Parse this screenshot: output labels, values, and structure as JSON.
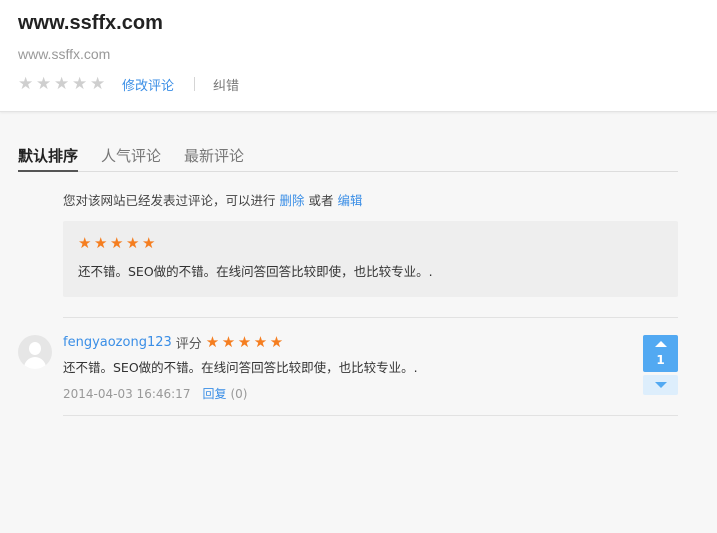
{
  "site": {
    "title": "www.ssffx.com",
    "url": "www.ssffx.com",
    "rating_stars": 5,
    "edit_review": "修改评论",
    "report": "纠错"
  },
  "tabs": [
    {
      "label": "默认排序",
      "active": true
    },
    {
      "label": "人气评论",
      "active": false
    },
    {
      "label": "最新评论",
      "active": false
    }
  ],
  "notice": {
    "prefix": "您对该网站已经发表过评论，可以进行",
    "delete": "删除",
    "or": "或者",
    "edit": "编辑"
  },
  "my_review": {
    "stars": 5,
    "text": "还不错。SEO做的不错。在线问答回答比较即使，也比较专业。."
  },
  "comments": [
    {
      "username": "fengyaozong123",
      "score_label": "评分",
      "stars": 5,
      "text": "还不错。SEO做的不错。在线问答回答比较即使，也比较专业。.",
      "timestamp": "2014-04-03 16:46:17",
      "reply_label": "回复",
      "reply_count": "(0)",
      "votes": "1"
    }
  ],
  "colors": {
    "link": "#3a8ee6",
    "star_orange": "#f57e20",
    "star_empty": "#cfcfcf",
    "vote_blue": "#52a9f2"
  },
  "icons": [
    "star-icon",
    "avatar-placeholder",
    "vote-up-icon",
    "vote-down-icon"
  ]
}
